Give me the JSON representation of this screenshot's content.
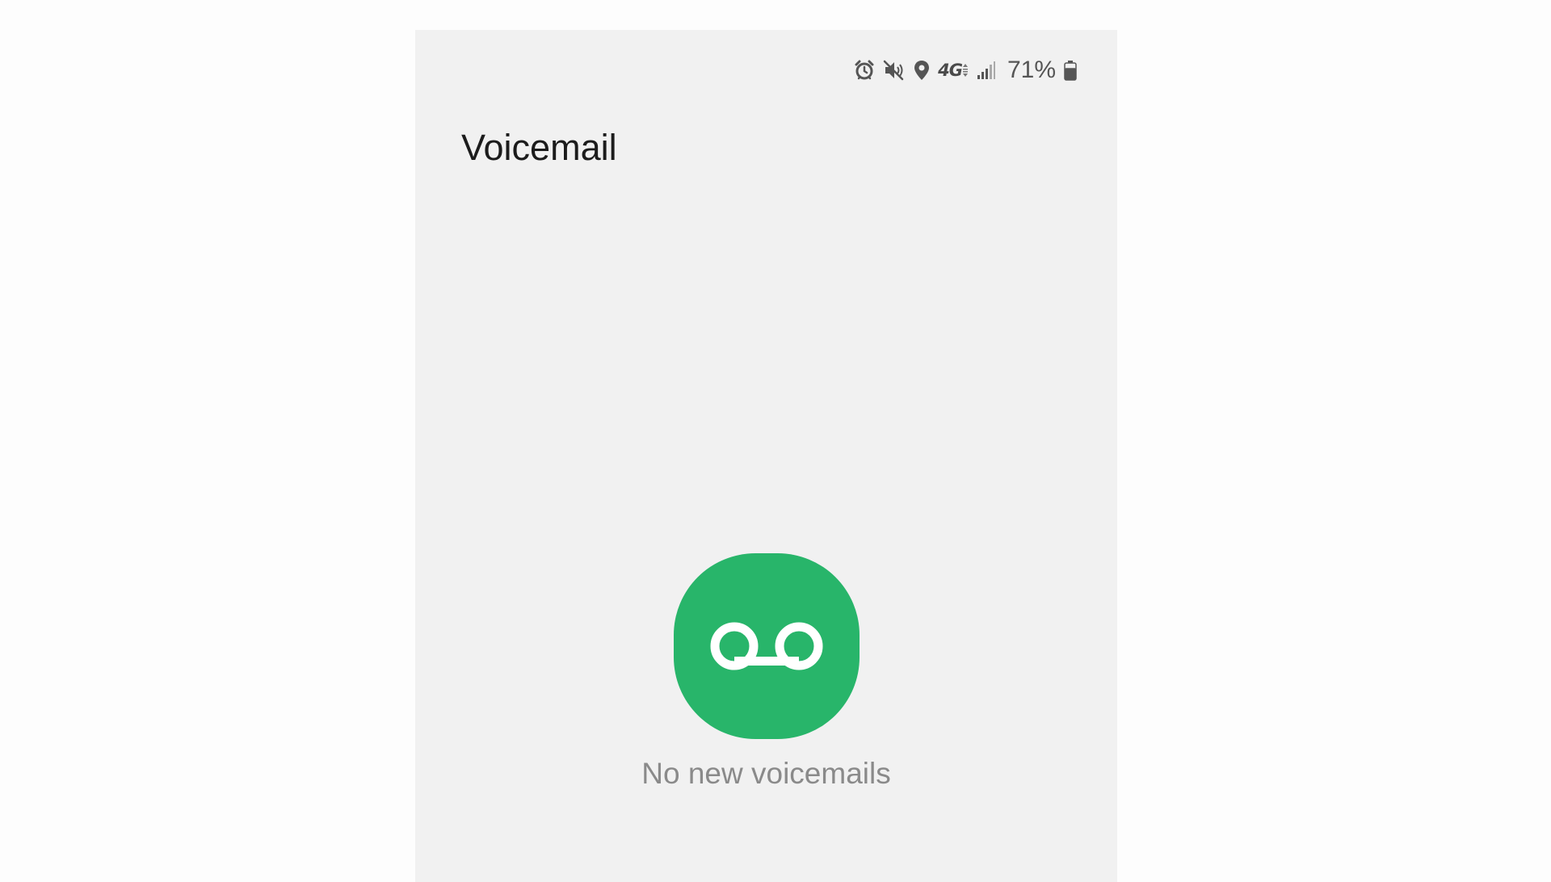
{
  "app": {
    "title": "Voicemail"
  },
  "status_bar": {
    "icons": [
      "alarm-icon",
      "mute-icon",
      "location-icon",
      "network-4g-icon",
      "signal-icon",
      "battery-icon"
    ],
    "network_label": "4G",
    "battery_percent": "71%",
    "battery_level": 0.71
  },
  "empty_state": {
    "icon": "voicemail-icon",
    "message": "No new voicemails"
  },
  "colors": {
    "accent": "#28b56a",
    "background": "#f1f1f1",
    "title_text": "#1c1c1c",
    "secondary_text": "#8a8a8a",
    "status_icons": "#555555"
  }
}
